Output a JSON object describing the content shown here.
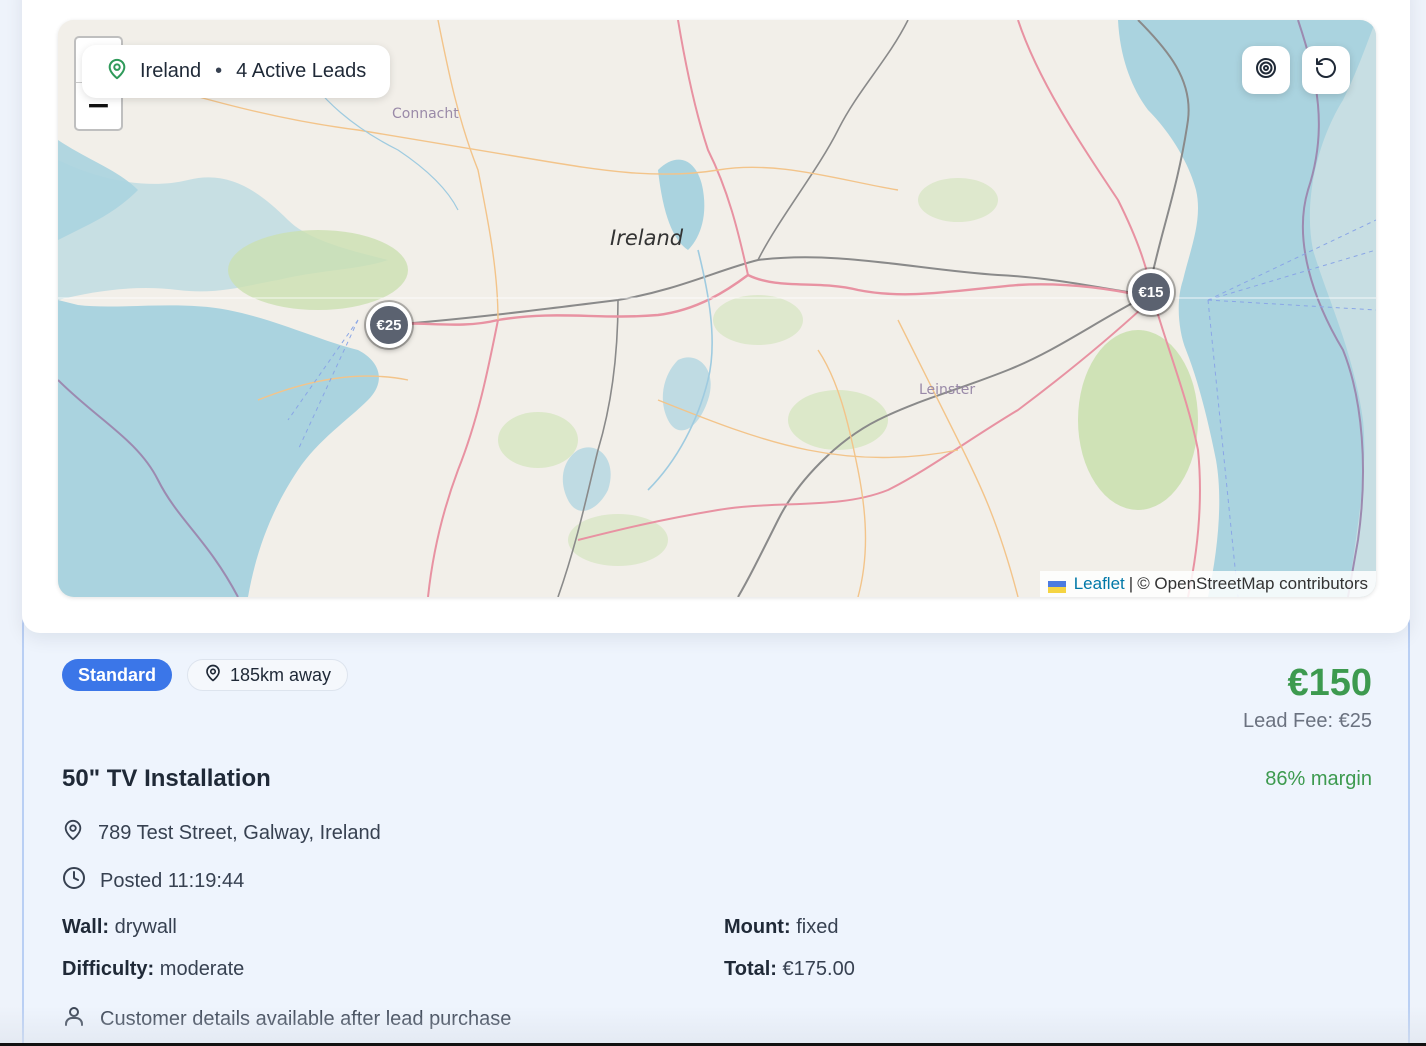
{
  "map": {
    "location_name": "Ireland",
    "separator": "•",
    "active_leads": "4 Active Leads",
    "zoom_in": "+",
    "zoom_out": "−",
    "labels": {
      "country": "Ireland",
      "region_connacht": "Connacht",
      "region_leinster": "Leinster"
    },
    "markers": [
      {
        "label": "€25"
      },
      {
        "label": "€15"
      }
    ],
    "attribution": {
      "leaflet": "Leaflet",
      "sep": "|",
      "osm": "© OpenStreetMap contributors"
    },
    "buttons": {
      "target_icon": "target-icon",
      "reset_icon": "refresh-icon"
    }
  },
  "lead": {
    "tier": "Standard",
    "distance": "185km away",
    "price": "€150",
    "lead_fee": "Lead Fee: €25",
    "title": "50\" TV Installation",
    "margin": "86% margin",
    "address": "789 Test Street, Galway, Ireland",
    "posted": "Posted 11:19:44",
    "specs": {
      "wall_label": "Wall:",
      "wall_value": "drywall",
      "mount_label": "Mount:",
      "mount_value": "fixed",
      "difficulty_label": "Difficulty:",
      "difficulty_value": "moderate",
      "total_label": "Total:",
      "total_value": "€175.00"
    },
    "customer_note": "Customer details available after lead purchase"
  },
  "colors": {
    "accent_blue": "#3b76e8",
    "price_green": "#3d9a4f",
    "sea": "#aad3df",
    "marker": "#5b6270"
  }
}
